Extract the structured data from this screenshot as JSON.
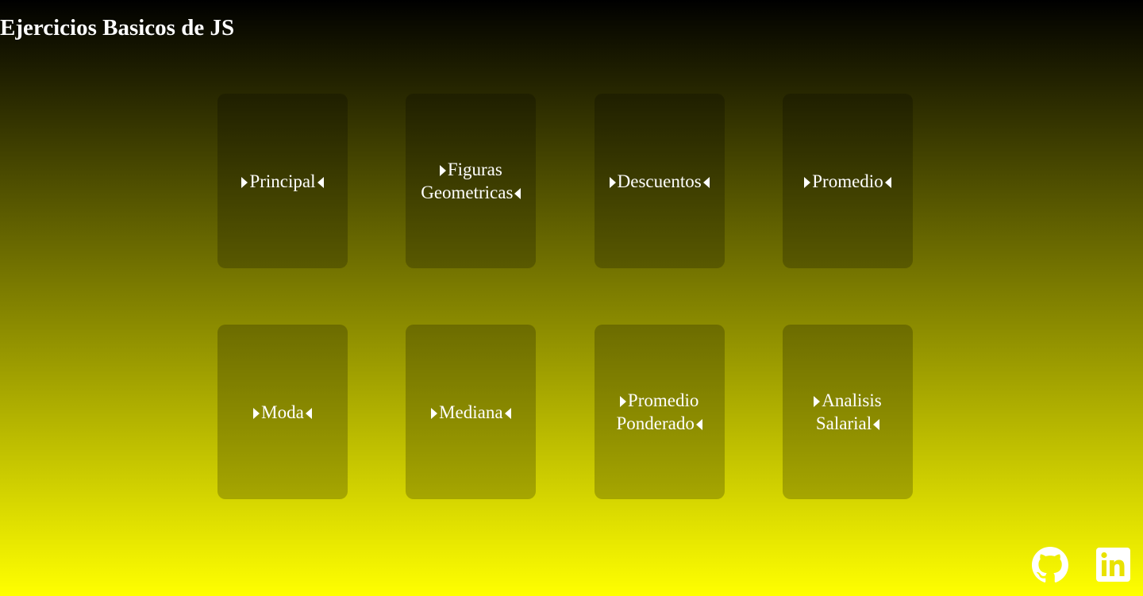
{
  "header": {
    "title": "Ejercicios Basicos de JS"
  },
  "cards": [
    {
      "line1": "Principal",
      "line2": ""
    },
    {
      "line1": "Figuras",
      "line2": "Geometricas"
    },
    {
      "line1": "Descuentos",
      "line2": ""
    },
    {
      "line1": "Promedio",
      "line2": ""
    },
    {
      "line1": "Moda",
      "line2": ""
    },
    {
      "line1": "Mediana",
      "line2": ""
    },
    {
      "line1": "Promedio",
      "line2": "Ponderado"
    },
    {
      "line1": "Analisis",
      "line2": "Salarial"
    }
  ],
  "footer": {
    "icons": [
      "github-icon",
      "linkedin-icon"
    ]
  },
  "colors": {
    "gradient_top": "#000000",
    "gradient_bottom": "#ffff00",
    "text": "#ffffff"
  }
}
